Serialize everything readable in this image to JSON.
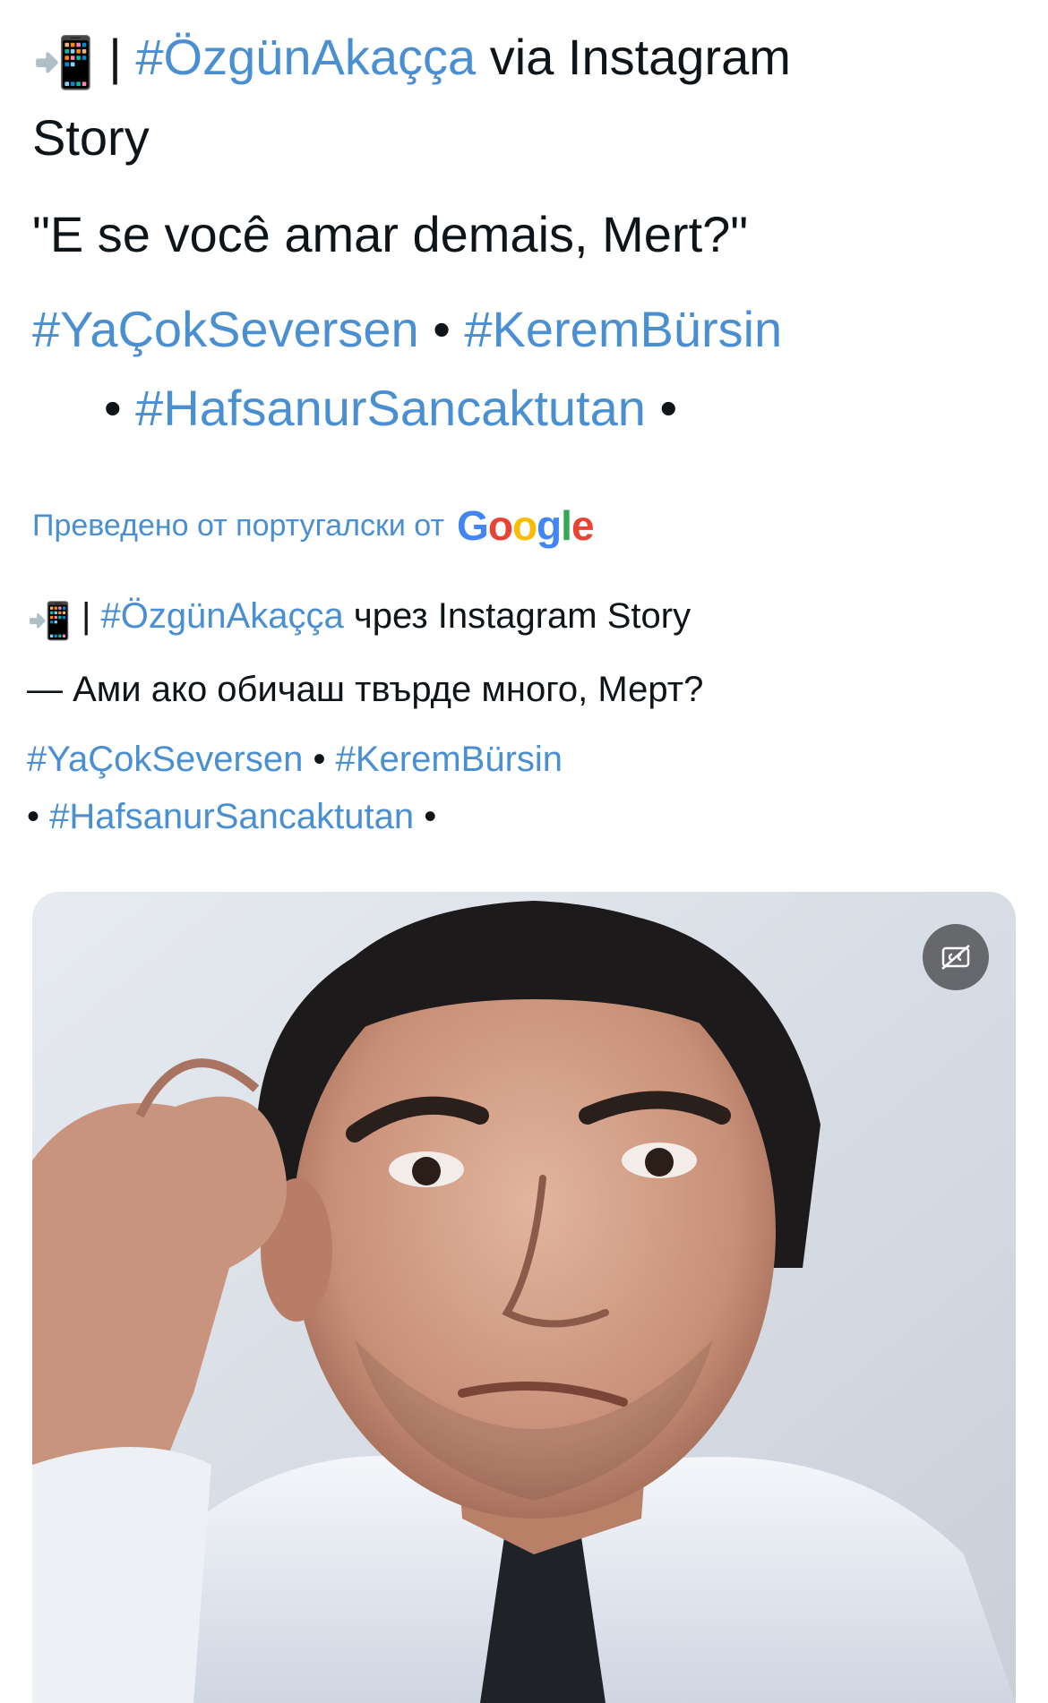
{
  "original": {
    "emoji": "📲",
    "divider": "|",
    "author_tag": "#ÖzgünAkaçça",
    "via_text": "via Instagram",
    "via_text_2": "Story",
    "quote": "\"E se você amar demais, Mert?\"",
    "tags": [
      "#YaÇokSeversen",
      "#KeremBürsin",
      "#HafsanurSancaktutan"
    ],
    "bullet": "•"
  },
  "translation": {
    "label": "Преведено от португалски от",
    "logo_letters": [
      "G",
      "o",
      "o",
      "g",
      "l",
      "e"
    ]
  },
  "translated": {
    "emoji": "📲",
    "divider": "|",
    "author_tag": "#ÖzgünAkaçça",
    "via_text": "чрез Instagram Story",
    "quote": "— Ами ако обичаш твърде много, Мерт?",
    "tags": [
      "#YaÇokSeversen",
      "#KeremBürsin",
      "#HafsanurSancaktutan"
    ],
    "bullet": "•"
  },
  "media": {
    "cc_icon": "captions-icon"
  },
  "colors": {
    "link": "#4a8fd1",
    "text": "#0f1419"
  }
}
